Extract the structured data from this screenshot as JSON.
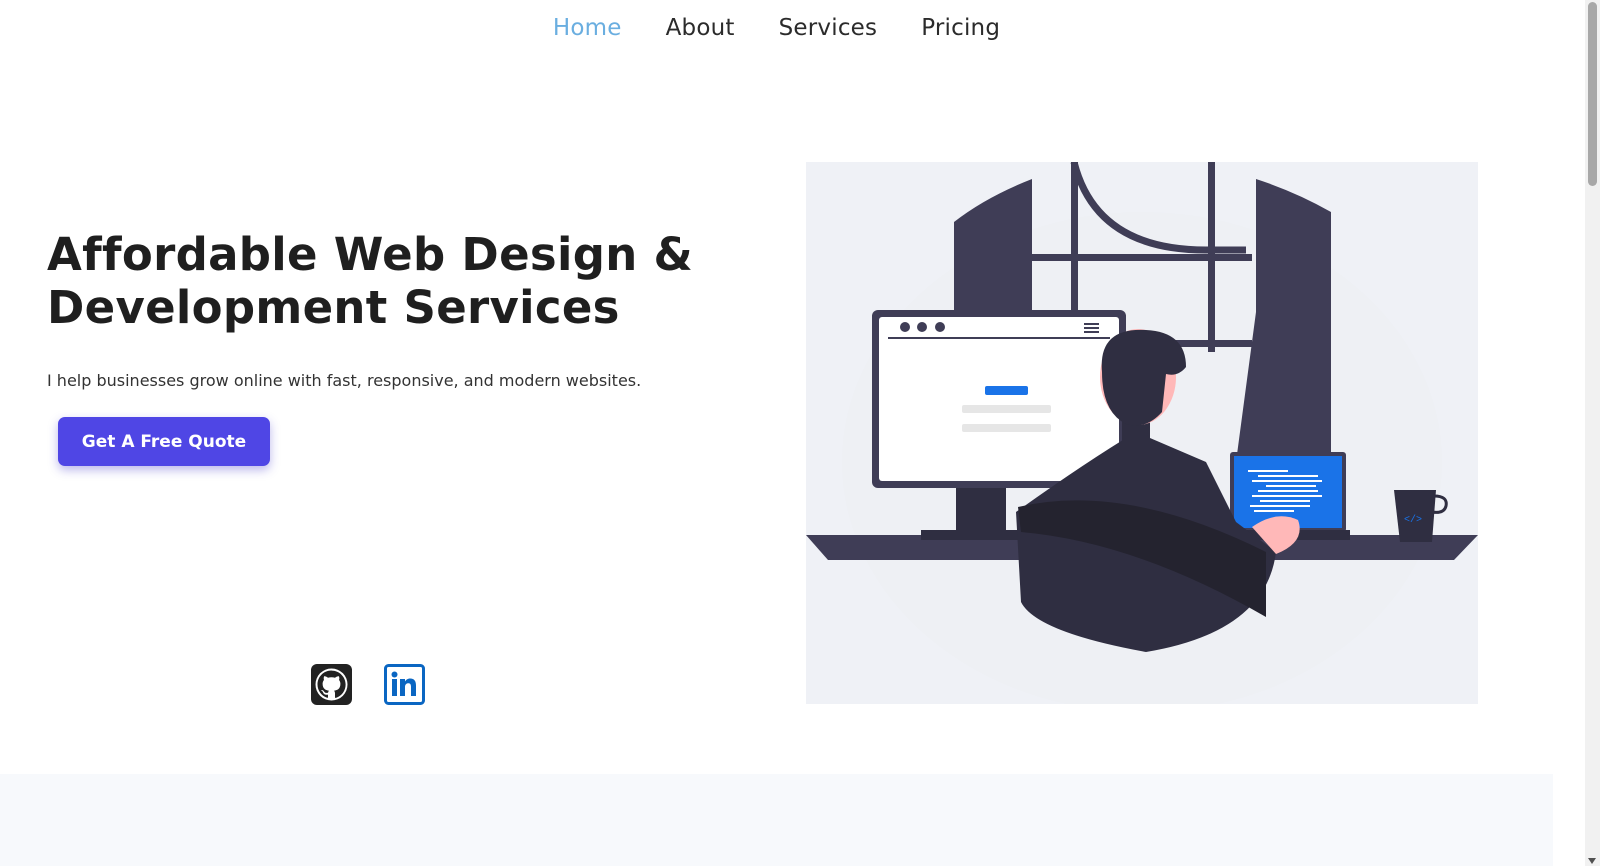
{
  "nav": {
    "items": [
      {
        "label": "Home",
        "active": true
      },
      {
        "label": "About",
        "active": false
      },
      {
        "label": "Services",
        "active": false
      },
      {
        "label": "Pricing",
        "active": false
      }
    ],
    "active_color": "#6aaee0"
  },
  "hero": {
    "title": "Affordable Web Design & Development Services",
    "subtitle": "I help businesses grow online with fast, responsive, and modern websites.",
    "cta_label": "Get A Free Quote",
    "cta_color": "#4f46e5"
  },
  "social": [
    {
      "icon": "github-icon"
    },
    {
      "icon": "linkedin-icon"
    }
  ],
  "illustration": {
    "icon": "developer-at-desk-illustration"
  }
}
